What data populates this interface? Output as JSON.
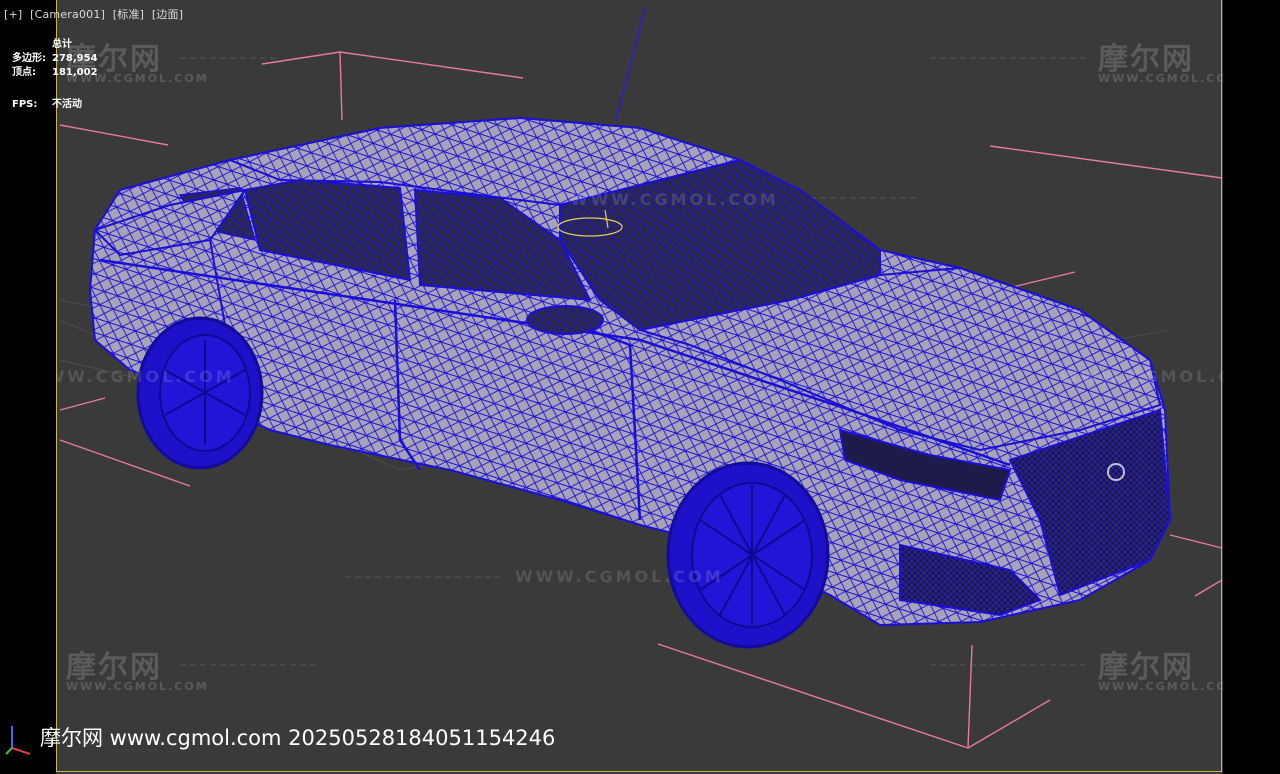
{
  "viewport": {
    "labels": [
      "[+]",
      "[Camera001]",
      "[标准]",
      "[边面]"
    ]
  },
  "stats": {
    "header": "总计",
    "polygons_label": "多边形:",
    "polygons_value": "278,954",
    "vertices_label": "顶点:",
    "vertices_value": "181,002",
    "fps_label": "FPS:",
    "fps_value": "不活动"
  },
  "watermarks": {
    "cn": "摩尔网",
    "en": "WWW.CGMOL.COM",
    "url": "WWW.CGMOL.COM"
  },
  "footer": {
    "text": "摩尔网 www.cgmol.com 20250528184051154246"
  },
  "colors": {
    "viewport_bg": "#3a3a3a",
    "wire": "#1a0fd6",
    "bbox": "#e87a9a",
    "border": "#c8b94a"
  },
  "icons": [
    "axis-tripod-icon"
  ]
}
